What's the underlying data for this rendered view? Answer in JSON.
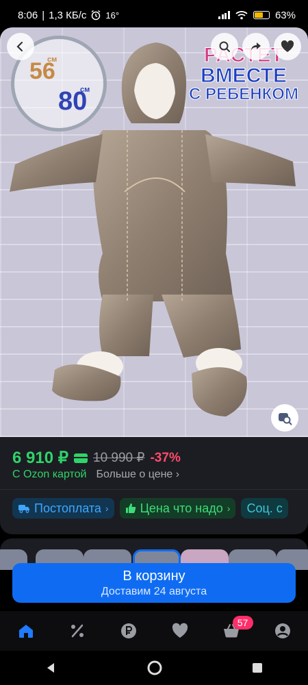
{
  "status_bar": {
    "time": "8:06",
    "network_speed": "1,3 КБ/с",
    "temperature": "16°",
    "battery_percent": "63%",
    "battery_level": 0.63
  },
  "hero": {
    "size_badge": {
      "from": "56",
      "to": "80",
      "unit": "см"
    },
    "promo": [
      "РАСТЁТ",
      "ВМЕСТЕ",
      "С РЕБЕНКОМ"
    ],
    "icons": {
      "back": "chevron-left-icon",
      "search": "search-icon",
      "share": "share-icon",
      "favorite": "heart-icon",
      "lens": "image-search-icon"
    }
  },
  "price": {
    "current": "6 910 ₽",
    "old": "10 990 ₽",
    "discount": "-37%",
    "with_card": "С Ozon картой",
    "more_link": "Больше о цене",
    "chevron": "›"
  },
  "chips": [
    {
      "label": "Постоплата",
      "chevron": "›"
    },
    {
      "label": "Цена что надо",
      "chevron": "›"
    },
    {
      "label": "Соц. с"
    }
  ],
  "cart": {
    "label": "В корзину",
    "delivery": "Доставим 24 августа"
  },
  "bottom_nav": {
    "cart_badge": "57",
    "items": [
      "home-icon",
      "percent-icon",
      "ruble-icon",
      "heart-icon",
      "basket-icon",
      "profile-icon"
    ]
  },
  "colors": {
    "accent_green": "#2fd36a",
    "discount_red": "#ff4b6b",
    "primary_blue": "#0f6cf2"
  }
}
